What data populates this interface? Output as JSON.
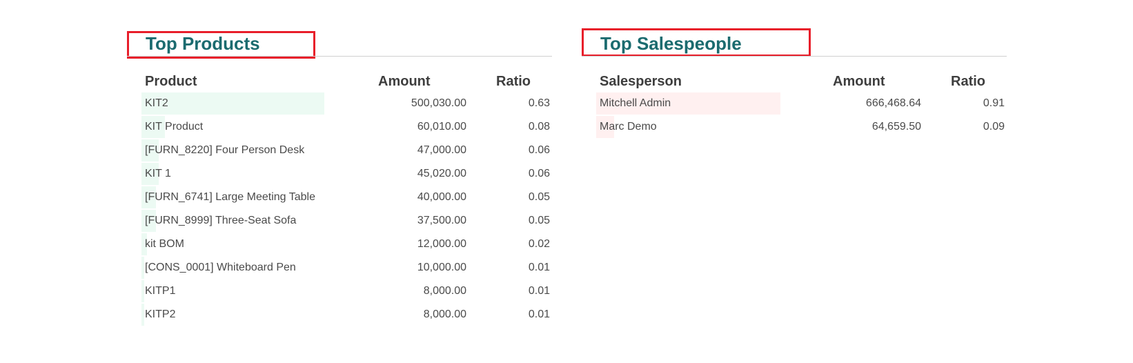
{
  "colors": {
    "title": "#1b6b6f",
    "highlight_border": "#e81e2a",
    "products_bar": "#ecfaf3",
    "salespeople_bar": "#fff0f0",
    "rule": "#cfcfcf"
  },
  "products": {
    "title": "Top Products",
    "columns": {
      "name": "Product",
      "amount": "Amount",
      "ratio": "Ratio"
    },
    "rows": [
      {
        "name": "KIT2",
        "amount": "500,030.00",
        "ratio": "0.63",
        "ratio_value": 0.63
      },
      {
        "name": "KIT Product",
        "amount": "60,010.00",
        "ratio": "0.08",
        "ratio_value": 0.08
      },
      {
        "name": "[FURN_8220] Four Person Desk",
        "amount": "47,000.00",
        "ratio": "0.06",
        "ratio_value": 0.06
      },
      {
        "name": "KIT 1",
        "amount": "45,020.00",
        "ratio": "0.06",
        "ratio_value": 0.06
      },
      {
        "name": "[FURN_6741] Large Meeting Table",
        "amount": "40,000.00",
        "ratio": "0.05",
        "ratio_value": 0.05
      },
      {
        "name": "[FURN_8999] Three-Seat Sofa",
        "amount": "37,500.00",
        "ratio": "0.05",
        "ratio_value": 0.05
      },
      {
        "name": "kit BOM",
        "amount": "12,000.00",
        "ratio": "0.02",
        "ratio_value": 0.02
      },
      {
        "name": "[CONS_0001] Whiteboard Pen",
        "amount": "10,000.00",
        "ratio": "0.01",
        "ratio_value": 0.01
      },
      {
        "name": "KITP1",
        "amount": "8,000.00",
        "ratio": "0.01",
        "ratio_value": 0.01
      },
      {
        "name": "KITP2",
        "amount": "8,000.00",
        "ratio": "0.01",
        "ratio_value": 0.01
      }
    ]
  },
  "salespeople": {
    "title": "Top Salespeople",
    "columns": {
      "name": "Salesperson",
      "amount": "Amount",
      "ratio": "Ratio"
    },
    "rows": [
      {
        "name": "Mitchell Admin",
        "amount": "666,468.64",
        "ratio": "0.91",
        "ratio_value": 0.91
      },
      {
        "name": "Marc Demo",
        "amount": "64,659.50",
        "ratio": "0.09",
        "ratio_value": 0.09
      }
    ]
  }
}
